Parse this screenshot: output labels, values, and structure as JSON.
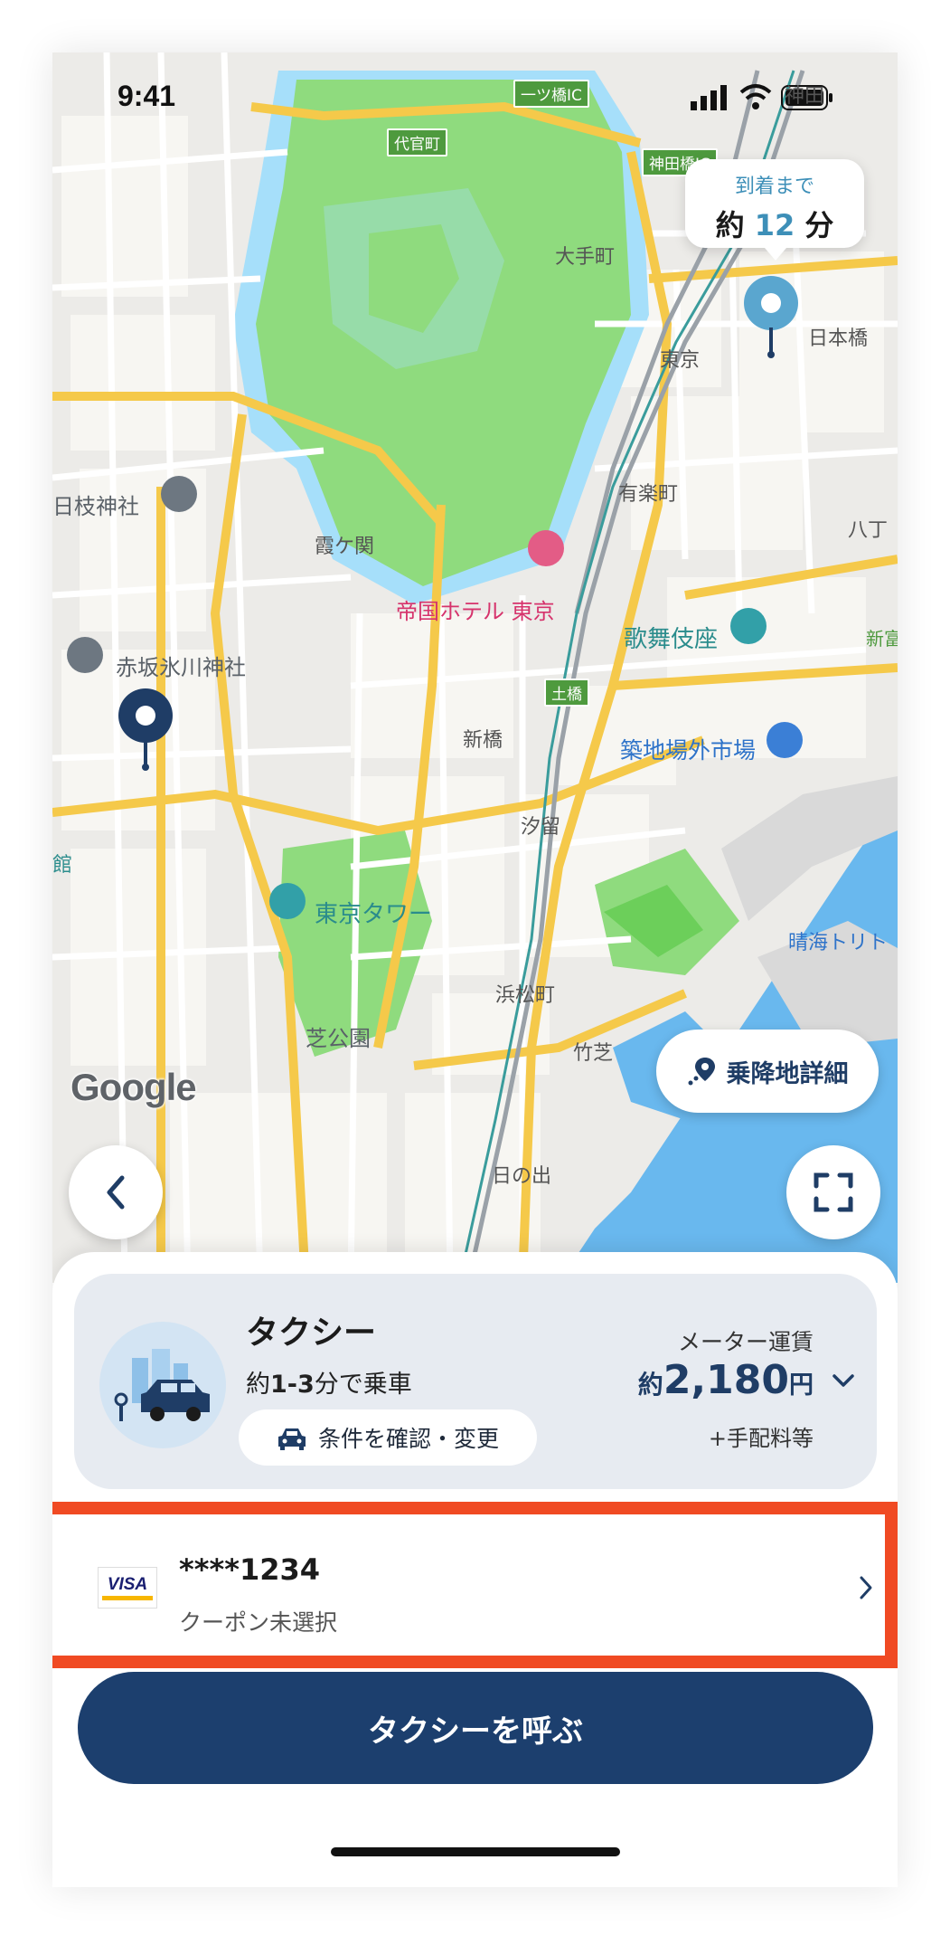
{
  "status_bar": {
    "time": "9:41"
  },
  "map": {
    "arrival_bubble": {
      "top_text": "到着まで",
      "prefix": "約",
      "minutes": "12",
      "unit": "分"
    },
    "labels": {
      "hitotsubashi_ic": "一ツ橋IC",
      "daikancho": "代官町",
      "kandabashi_ic": "神田橋IC",
      "otemachi": "大手町",
      "tokyo": "東京",
      "nihonbashi": "日本橋",
      "yurakucho": "有楽町",
      "hie_jinja": "日枝神社",
      "kasumigaseki": "霞ケ関",
      "teikoku_hotel": "帝国ホテル 東京",
      "kabukiza": "歌舞伎座",
      "akasaka_hikawa": "赤坂氷川神社",
      "dobashi": "土橋",
      "shimbashi": "新橋",
      "tsukiji_market": "築地場外市場",
      "shiodome": "汐留",
      "kan": "館",
      "tokyo_tower": "東京タワー",
      "harumi": "晴海トリト",
      "hamamatsucho": "浜松町",
      "shibakoen": "芝公園",
      "takeshiba": "竹芝",
      "hinode": "日の出",
      "shintomi": "新富",
      "kanda": "神田",
      "kyobashi": "八丁"
    },
    "google_logo": "Google",
    "pickup_details_label": "乗降地詳細"
  },
  "taxi_option": {
    "title": "タクシー",
    "eta_prefix": "約",
    "eta_range": "1-3",
    "eta_suffix": "分で乗車",
    "conditions_button": "条件を確認・変更",
    "fare_label": "メーター運賃",
    "fare_prefix": "約",
    "fare_amount": "2,180",
    "fare_unit": "円",
    "fare_extra": "+手配料等"
  },
  "payment": {
    "card_brand": "VISA",
    "card_number": "****1234",
    "coupon_status": "クーポン未選択"
  },
  "call_button": "タクシーを呼ぶ",
  "colors": {
    "primary": "#1c3f6e",
    "accent_blue": "#3d8fb8",
    "highlight_red": "#f04a23",
    "park_green": "#8fdb7e",
    "water_blue": "#69b8ee",
    "road_yellow": "#f5c94a"
  }
}
